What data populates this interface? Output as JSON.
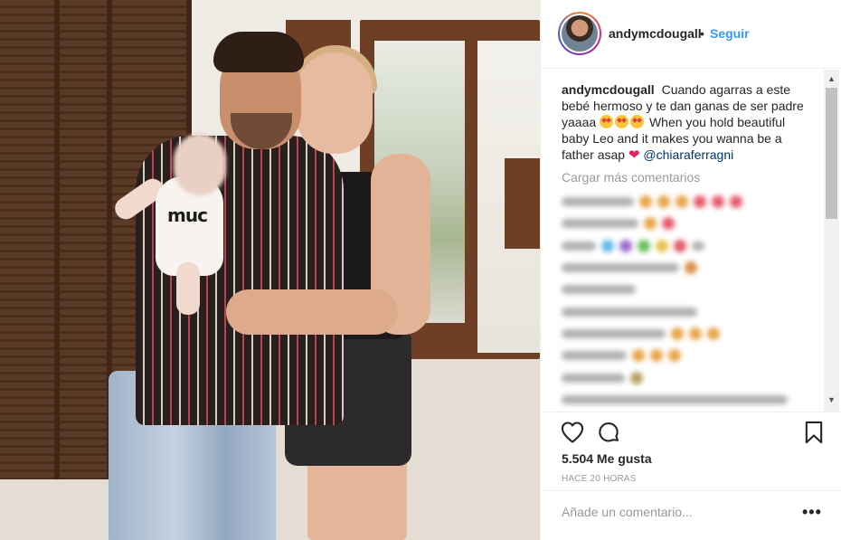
{
  "post": {
    "username": "andymcdougall",
    "follow_label": "Seguir",
    "separator": "•",
    "photo_print": "muc"
  },
  "caption": {
    "username": "andymcdougall",
    "text_part1": "Cuando agarras a este bebé hermoso y te dan ganas de ser padre yaaaa",
    "text_part2": "When you hold beautiful baby Leo and it makes you wanna be a father asap",
    "heart": "❤",
    "mention": "@chiaraferragni"
  },
  "comments": {
    "load_more_label": "Cargar más comentarios"
  },
  "actions": {
    "likes_text": "5.504 Me gusta",
    "timestamp": "HACE 20 HORAS"
  },
  "add_comment": {
    "placeholder": "Añade un comentario...",
    "more_label": "•••"
  },
  "scrollbar": {
    "up_arrow": "▲",
    "down_arrow": "▼"
  },
  "colors": {
    "link_blue": "#3897f0",
    "mention_blue": "#003569",
    "heart_red": "#e0245e",
    "muted_gray": "#999999"
  },
  "icons": [
    "heart-outline-icon",
    "comment-bubble-icon",
    "bookmark-icon",
    "avatar"
  ]
}
